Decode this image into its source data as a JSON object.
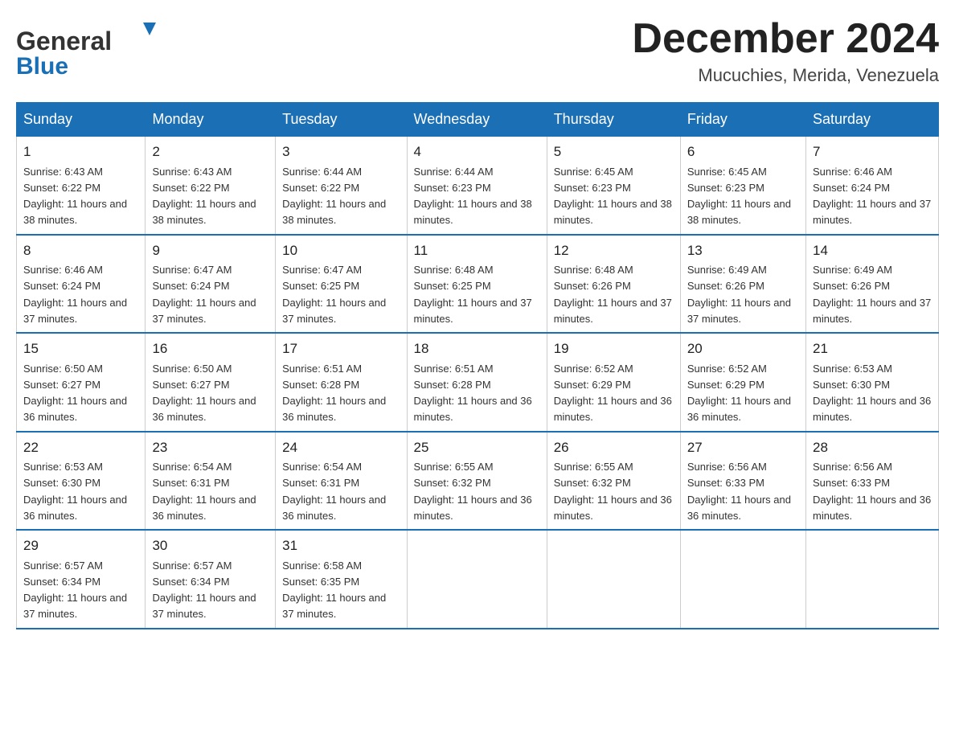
{
  "header": {
    "logo_line1": "General",
    "logo_line2": "Blue",
    "month": "December 2024",
    "location": "Mucuchies, Merida, Venezuela"
  },
  "weekdays": [
    "Sunday",
    "Monday",
    "Tuesday",
    "Wednesday",
    "Thursday",
    "Friday",
    "Saturday"
  ],
  "weeks": [
    [
      {
        "day": "1",
        "sunrise": "6:43 AM",
        "sunset": "6:22 PM",
        "daylight": "11 hours and 38 minutes."
      },
      {
        "day": "2",
        "sunrise": "6:43 AM",
        "sunset": "6:22 PM",
        "daylight": "11 hours and 38 minutes."
      },
      {
        "day": "3",
        "sunrise": "6:44 AM",
        "sunset": "6:22 PM",
        "daylight": "11 hours and 38 minutes."
      },
      {
        "day": "4",
        "sunrise": "6:44 AM",
        "sunset": "6:23 PM",
        "daylight": "11 hours and 38 minutes."
      },
      {
        "day": "5",
        "sunrise": "6:45 AM",
        "sunset": "6:23 PM",
        "daylight": "11 hours and 38 minutes."
      },
      {
        "day": "6",
        "sunrise": "6:45 AM",
        "sunset": "6:23 PM",
        "daylight": "11 hours and 38 minutes."
      },
      {
        "day": "7",
        "sunrise": "6:46 AM",
        "sunset": "6:24 PM",
        "daylight": "11 hours and 37 minutes."
      }
    ],
    [
      {
        "day": "8",
        "sunrise": "6:46 AM",
        "sunset": "6:24 PM",
        "daylight": "11 hours and 37 minutes."
      },
      {
        "day": "9",
        "sunrise": "6:47 AM",
        "sunset": "6:24 PM",
        "daylight": "11 hours and 37 minutes."
      },
      {
        "day": "10",
        "sunrise": "6:47 AM",
        "sunset": "6:25 PM",
        "daylight": "11 hours and 37 minutes."
      },
      {
        "day": "11",
        "sunrise": "6:48 AM",
        "sunset": "6:25 PM",
        "daylight": "11 hours and 37 minutes."
      },
      {
        "day": "12",
        "sunrise": "6:48 AM",
        "sunset": "6:26 PM",
        "daylight": "11 hours and 37 minutes."
      },
      {
        "day": "13",
        "sunrise": "6:49 AM",
        "sunset": "6:26 PM",
        "daylight": "11 hours and 37 minutes."
      },
      {
        "day": "14",
        "sunrise": "6:49 AM",
        "sunset": "6:26 PM",
        "daylight": "11 hours and 37 minutes."
      }
    ],
    [
      {
        "day": "15",
        "sunrise": "6:50 AM",
        "sunset": "6:27 PM",
        "daylight": "11 hours and 36 minutes."
      },
      {
        "day": "16",
        "sunrise": "6:50 AM",
        "sunset": "6:27 PM",
        "daylight": "11 hours and 36 minutes."
      },
      {
        "day": "17",
        "sunrise": "6:51 AM",
        "sunset": "6:28 PM",
        "daylight": "11 hours and 36 minutes."
      },
      {
        "day": "18",
        "sunrise": "6:51 AM",
        "sunset": "6:28 PM",
        "daylight": "11 hours and 36 minutes."
      },
      {
        "day": "19",
        "sunrise": "6:52 AM",
        "sunset": "6:29 PM",
        "daylight": "11 hours and 36 minutes."
      },
      {
        "day": "20",
        "sunrise": "6:52 AM",
        "sunset": "6:29 PM",
        "daylight": "11 hours and 36 minutes."
      },
      {
        "day": "21",
        "sunrise": "6:53 AM",
        "sunset": "6:30 PM",
        "daylight": "11 hours and 36 minutes."
      }
    ],
    [
      {
        "day": "22",
        "sunrise": "6:53 AM",
        "sunset": "6:30 PM",
        "daylight": "11 hours and 36 minutes."
      },
      {
        "day": "23",
        "sunrise": "6:54 AM",
        "sunset": "6:31 PM",
        "daylight": "11 hours and 36 minutes."
      },
      {
        "day": "24",
        "sunrise": "6:54 AM",
        "sunset": "6:31 PM",
        "daylight": "11 hours and 36 minutes."
      },
      {
        "day": "25",
        "sunrise": "6:55 AM",
        "sunset": "6:32 PM",
        "daylight": "11 hours and 36 minutes."
      },
      {
        "day": "26",
        "sunrise": "6:55 AM",
        "sunset": "6:32 PM",
        "daylight": "11 hours and 36 minutes."
      },
      {
        "day": "27",
        "sunrise": "6:56 AM",
        "sunset": "6:33 PM",
        "daylight": "11 hours and 36 minutes."
      },
      {
        "day": "28",
        "sunrise": "6:56 AM",
        "sunset": "6:33 PM",
        "daylight": "11 hours and 36 minutes."
      }
    ],
    [
      {
        "day": "29",
        "sunrise": "6:57 AM",
        "sunset": "6:34 PM",
        "daylight": "11 hours and 37 minutes."
      },
      {
        "day": "30",
        "sunrise": "6:57 AM",
        "sunset": "6:34 PM",
        "daylight": "11 hours and 37 minutes."
      },
      {
        "day": "31",
        "sunrise": "6:58 AM",
        "sunset": "6:35 PM",
        "daylight": "11 hours and 37 minutes."
      },
      null,
      null,
      null,
      null
    ]
  ]
}
